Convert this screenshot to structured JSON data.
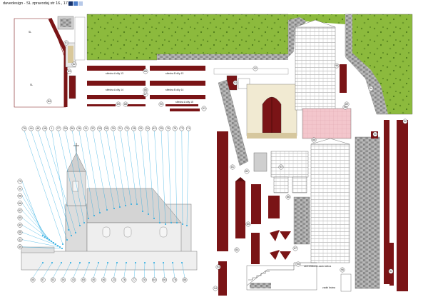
{
  "header": {
    "text": "davedesign - SL zpravodaj  str 16., 17."
  },
  "colors": {
    "swatches": [
      "#15316b",
      "#4a7cc9",
      "#b7c9e8"
    ],
    "grass": "#8cba3d",
    "roof": "#7a1416",
    "wall": "#e8e8e8",
    "stone": "#9a9a9a",
    "tile": "#f3c6cc",
    "callout": "#21a8e0"
  },
  "strip_labels": {
    "a": "střecha A díly 13",
    "b": "střecha B díly 13",
    "c": "střecha A díly 14",
    "d": "střecha B díly 14",
    "e": "střecha A díly 15"
  },
  "notes": {
    "wall": "zeď hřbitovní\nzadní stěna",
    "gate": "zadní brána"
  },
  "callouts": {
    "top_row": [
      "76",
      "44",
      "45",
      "46",
      "1",
      "27",
      "28",
      "36",
      "26",
      "31",
      "32",
      "35",
      "28",
      "30",
      "74",
      "75",
      "28",
      "29",
      "34",
      "42",
      "35",
      "78",
      "78",
      "72",
      "71"
    ],
    "left_col": [
      "75",
      "8",
      "68",
      "66",
      "62",
      "65",
      "42",
      "66",
      "33",
      "39"
    ],
    "bottom_row": [
      "55",
      "57",
      "53",
      "54",
      "43",
      "65",
      "40",
      "46",
      "23",
      "76",
      "77",
      "78",
      "64",
      "60",
      "78",
      "88"
    ],
    "parts": [
      "81",
      "82",
      "83",
      "84",
      "85",
      "86",
      "87",
      "88",
      "89",
      "90",
      "91",
      "92",
      "93",
      "94",
      "95",
      "96"
    ]
  }
}
